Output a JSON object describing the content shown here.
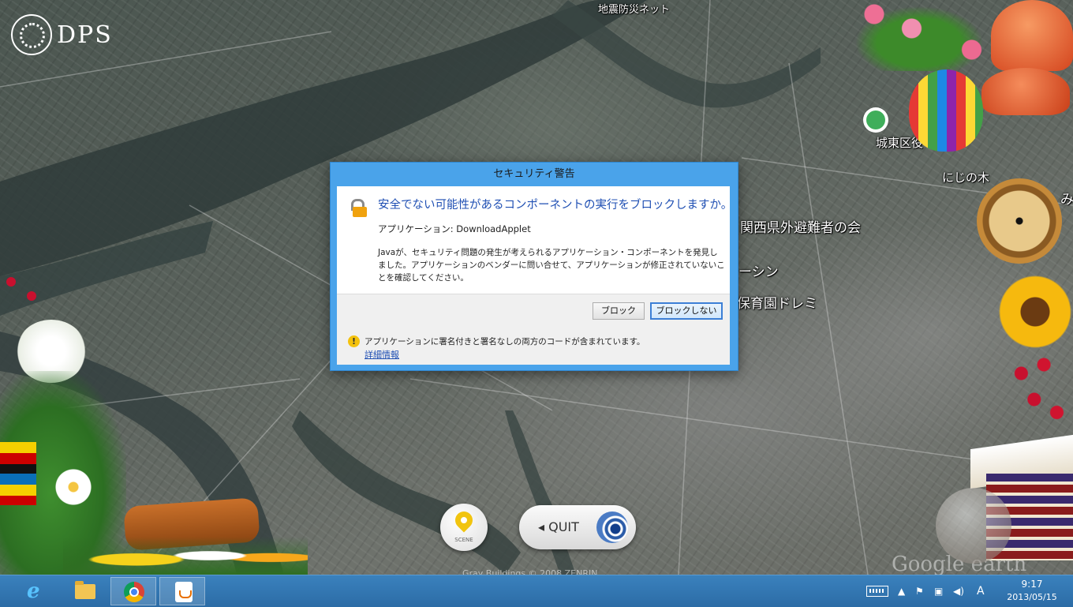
{
  "logo": {
    "text": "DPS"
  },
  "map": {
    "labels": {
      "top_network": "地震防災ネット",
      "ward_office": "城東区役",
      "nijinoki": "にじの木",
      "kansai_evac": "関西県外避難者の会",
      "station_fragment": "ーシン",
      "nursery": "保育園ドレミ",
      "right_fragment": "み"
    },
    "attribution": "Gray Buildings © 2008 ZENRIN",
    "watermark": "Google earth"
  },
  "controls": {
    "scene_label": "SCENE",
    "quit_label": "◂ QUIT"
  },
  "dialog": {
    "title": "セキュリティ警告",
    "heading": "安全でない可能性があるコンポーネントの実行をブロックしますか。",
    "application_line": "アプリケーション: DownloadApplet",
    "body": "Javaが、セキュリティ問題の発生が考えられるアプリケーション・コンポーネントを発見しました。アプリケーションのベンダーに問い合せて、アプリケーションが修正されていないことを確認してください。",
    "buttons": {
      "block": "ブロック",
      "dont_block": "ブロックしない"
    },
    "warning": "アプリケーションに署名付きと署名なしの両方のコードが含まれています。",
    "details_link": "詳細情報"
  },
  "taskbar": {
    "apps": [
      "internet-explorer",
      "file-explorer",
      "chrome",
      "java"
    ],
    "ime_indicator": "A",
    "clock_time": "9:17",
    "clock_date": "2013/05/15"
  }
}
